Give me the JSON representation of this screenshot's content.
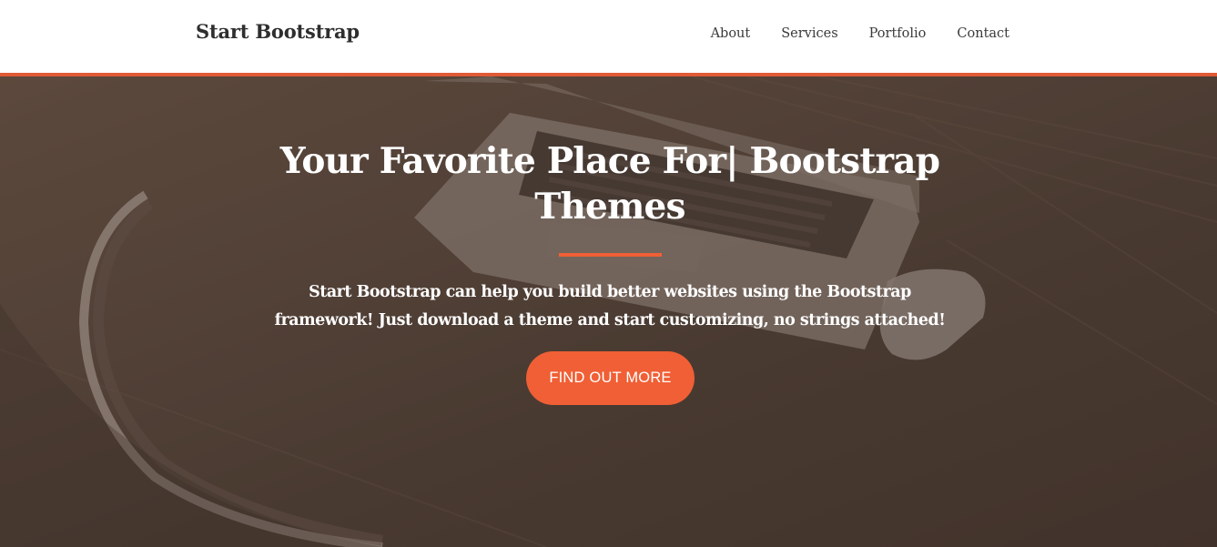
{
  "navbar": {
    "brand": "Start Bootstrap",
    "links": [
      "About",
      "Services",
      "Portfolio",
      "Contact"
    ]
  },
  "hero": {
    "title": "Your Favorite Place For| Bootstrap Themes",
    "text": "Start Bootstrap can help you build better websites using the Bootstrap framework! Just download a theme and start customizing, no strings attached!",
    "button": "FIND OUT MORE"
  },
  "colors": {
    "accent": "#f05f35",
    "navbar_bg": "#ffffff",
    "hero_overlay": "#4a3b33",
    "text_light": "#ffffff"
  }
}
